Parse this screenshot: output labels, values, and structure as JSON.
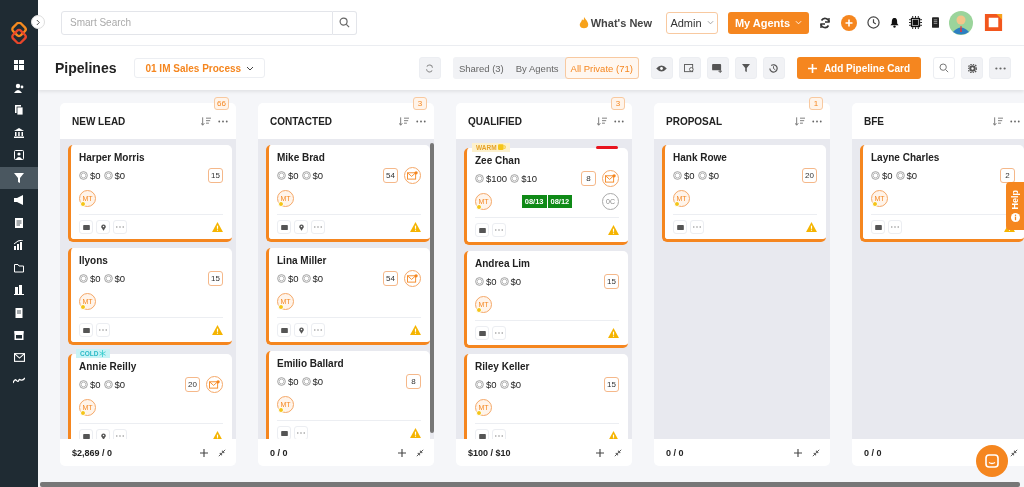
{
  "sidebar": {
    "items": [
      {
        "kind": "dashboard",
        "selected": false
      },
      {
        "kind": "people",
        "selected": false
      },
      {
        "kind": "documents",
        "selected": false
      },
      {
        "kind": "bank",
        "selected": false
      },
      {
        "kind": "contact",
        "selected": false
      },
      {
        "kind": "funnel",
        "selected": true
      },
      {
        "kind": "megaphone",
        "selected": false
      },
      {
        "kind": "list",
        "selected": false
      },
      {
        "kind": "chart",
        "selected": false
      },
      {
        "kind": "folder",
        "selected": false
      },
      {
        "kind": "buildings",
        "selected": false
      },
      {
        "kind": "notes",
        "selected": false
      },
      {
        "kind": "calendar",
        "selected": false
      },
      {
        "kind": "mail",
        "selected": false
      },
      {
        "kind": "signature",
        "selected": false
      }
    ]
  },
  "header": {
    "search": {
      "placeholder": "Smart Search"
    },
    "whats_new": "What's New",
    "role": "Admin",
    "agents_button": "My Agents"
  },
  "toolbar": {
    "title": "Pipelines",
    "pipeline": "01 IM Sales Process",
    "views": [
      {
        "label": "Shared (3)",
        "selected": false
      },
      {
        "label": "By Agents",
        "selected": false
      },
      {
        "label": "All Private (71)",
        "selected": true
      }
    ],
    "add_button": "Add Pipeline Card"
  },
  "columns": [
    {
      "title": "NEW LEAD",
      "count": "66",
      "total": "$2,869 / 0",
      "scrollbar": false,
      "cards": [
        {
          "name": "Harper Morris",
          "amounts": [
            "$0",
            "$0"
          ],
          "count": "15",
          "mail": false,
          "avatar": "MT",
          "pin": true
        },
        {
          "name": "Ilyons",
          "amounts": [
            "$0",
            "$0"
          ],
          "count": "15",
          "mail": false,
          "avatar": "MT",
          "pin": false
        },
        {
          "name": "Annie Reilly",
          "tag": {
            "label": "COLD",
            "kind": "cold"
          },
          "amounts": [
            "$0",
            "$0"
          ],
          "count": "20",
          "mail": true,
          "avatar": "MT",
          "pin": true
        }
      ]
    },
    {
      "title": "CONTACTED",
      "count": "3",
      "total": "0 / 0",
      "scrollbar": true,
      "cards": [
        {
          "name": "Mike Brad",
          "amounts": [
            "$0",
            "$0"
          ],
          "count": "54",
          "mail": true,
          "avatar": "MT",
          "pin": true
        },
        {
          "name": "Lina Miller",
          "amounts": [
            "$0",
            "$0"
          ],
          "count": "54",
          "mail": true,
          "avatar": "MT",
          "pin": true
        },
        {
          "name": "Emilio Ballard",
          "amounts": [
            "$0",
            "$0"
          ],
          "count": "8",
          "mail": false,
          "avatar": "MT",
          "pin": false
        }
      ]
    },
    {
      "title": "QUALIFIED",
      "count": "3",
      "total": "$100 / $10",
      "scrollbar": false,
      "cards": [
        {
          "name": "Zee Chan",
          "tag": {
            "label": "WARM",
            "kind": "warm"
          },
          "priority": true,
          "amounts": [
            "$100",
            "$10"
          ],
          "count": "8",
          "mail": true,
          "avatar": "MT",
          "dates": [
            "08/13",
            "08/12"
          ],
          "extra": "0C",
          "pin": false
        },
        {
          "name": "Andrea Lim",
          "amounts": [
            "$0",
            "$0"
          ],
          "count": "15",
          "mail": false,
          "avatar": "MT",
          "pin": false
        },
        {
          "name": "Riley Keller",
          "amounts": [
            "$0",
            "$0"
          ],
          "count": "15",
          "mail": false,
          "avatar": "MT",
          "pin": false
        }
      ]
    },
    {
      "title": "PROPOSAL",
      "count": "1",
      "total": "0 / 0",
      "scrollbar": false,
      "cards": [
        {
          "name": "Hank Rowe",
          "amounts": [
            "$0",
            "$0"
          ],
          "count": "20",
          "mail": false,
          "avatar": "MT",
          "pin": false
        }
      ]
    },
    {
      "title": "BFE",
      "total": "0 / 0",
      "scrollbar": false,
      "cards": [
        {
          "name": "Layne Charles",
          "amounts": [
            "$0",
            "$0"
          ],
          "count": "2",
          "mail": false,
          "avatar": "MT",
          "pin": false
        }
      ]
    }
  ],
  "help_tab": "Help"
}
